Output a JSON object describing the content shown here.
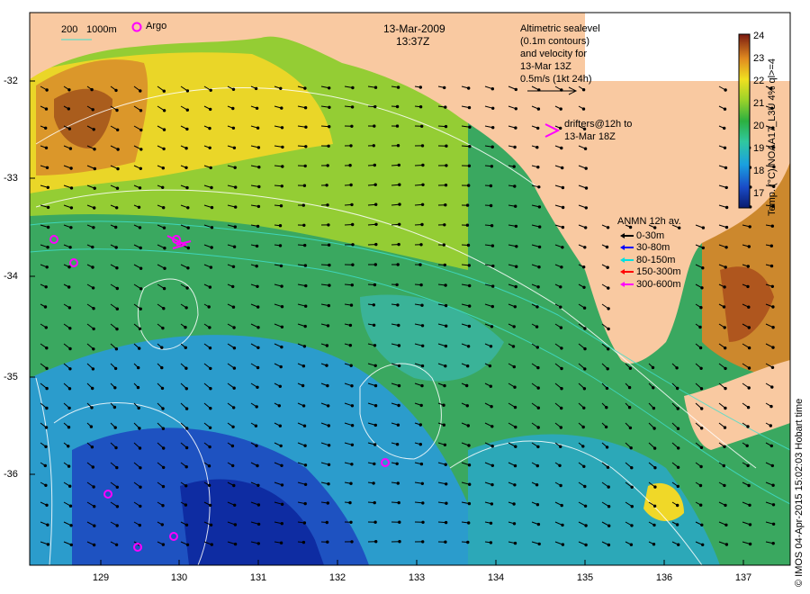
{
  "header": {
    "date": "13-Mar-2009",
    "time": "13:37Z"
  },
  "scale_bar": {
    "label_a": "200",
    "label_b": "1000m"
  },
  "argo": {
    "label": "Argo"
  },
  "altimetry": {
    "lines": [
      "Altimetric sealevel",
      "(0.1m contours)",
      "and velocity for",
      "13-Mar 13Z",
      "0.5m/s (1kt 24h)"
    ]
  },
  "drifters": {
    "lines": [
      "drifters@12h to",
      "13-Mar 18Z"
    ],
    "color": "#ff00ff"
  },
  "anmn": {
    "title": "ANMN 12h av.",
    "items": [
      {
        "label": "0-30m",
        "color": "#000000"
      },
      {
        "label": "30-80m",
        "color": "#0000ff"
      },
      {
        "label": "80-150m",
        "color": "#00e0e0"
      },
      {
        "label": "150-300m",
        "color": "#ff0000"
      },
      {
        "label": "300-600m",
        "color": "#ff00ff"
      }
    ]
  },
  "colorbar": {
    "title": "Temp. (°C) NOAA17_L3U 4% ql>=4",
    "ticks": [
      "24",
      "23",
      "22",
      "21",
      "20",
      "19",
      "18",
      "17"
    ]
  },
  "axes": {
    "y_ticks": [
      "-32",
      "-33",
      "-34",
      "-35",
      "-36"
    ],
    "x_ticks": [
      "129",
      "130",
      "131",
      "132",
      "133",
      "134",
      "135",
      "136",
      "137"
    ]
  },
  "credit": "© IMOS 04-Apr-2015 15:02:03 Hobart time",
  "colors": {
    "land": "#f9c9a1",
    "frame": "#000000"
  }
}
